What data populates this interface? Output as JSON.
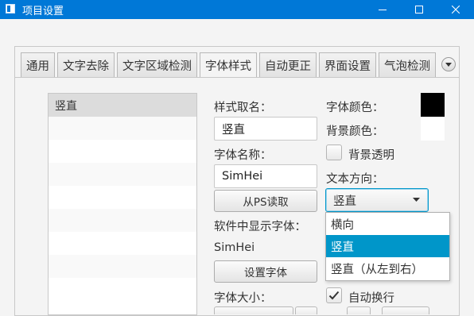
{
  "window": {
    "title": "项目设置"
  },
  "tabs": [
    {
      "label": "通用"
    },
    {
      "label": "文字去除"
    },
    {
      "label": "文字区域检测"
    },
    {
      "label": "字体样式"
    },
    {
      "label": "自动更正"
    },
    {
      "label": "界面设置"
    },
    {
      "label": "气泡检测"
    }
  ],
  "active_tab": "字体样式",
  "style_list": {
    "items": [
      "竖直"
    ],
    "selected": "竖直"
  },
  "form": {
    "style_name_label": "样式取名：",
    "style_name_value": "竖直",
    "font_name_label": "字体名称：",
    "font_name_value": "SimHei",
    "read_ps_button": "从PS读取",
    "display_font_label": "软件中显示字体：",
    "display_font_value": "SimHei",
    "set_font_button": "设置字体",
    "font_size_label": "字体大小：",
    "font_color_label": "字体颜色：",
    "font_color": "#000000",
    "bg_color_label": "背景颜色：",
    "bg_color": "#ffffff",
    "bg_transparent_label": "背景透明",
    "bg_transparent_checked": false,
    "text_direction_label": "文本方向：",
    "text_direction_value": "竖直",
    "text_direction_options": [
      "横向",
      "竖直",
      "竖直（从左到右）"
    ],
    "auto_wrap_label": "自动换行",
    "auto_wrap_checked": true
  },
  "colors": {
    "titlebar": "#0078d7",
    "accent": "#0096c9"
  }
}
